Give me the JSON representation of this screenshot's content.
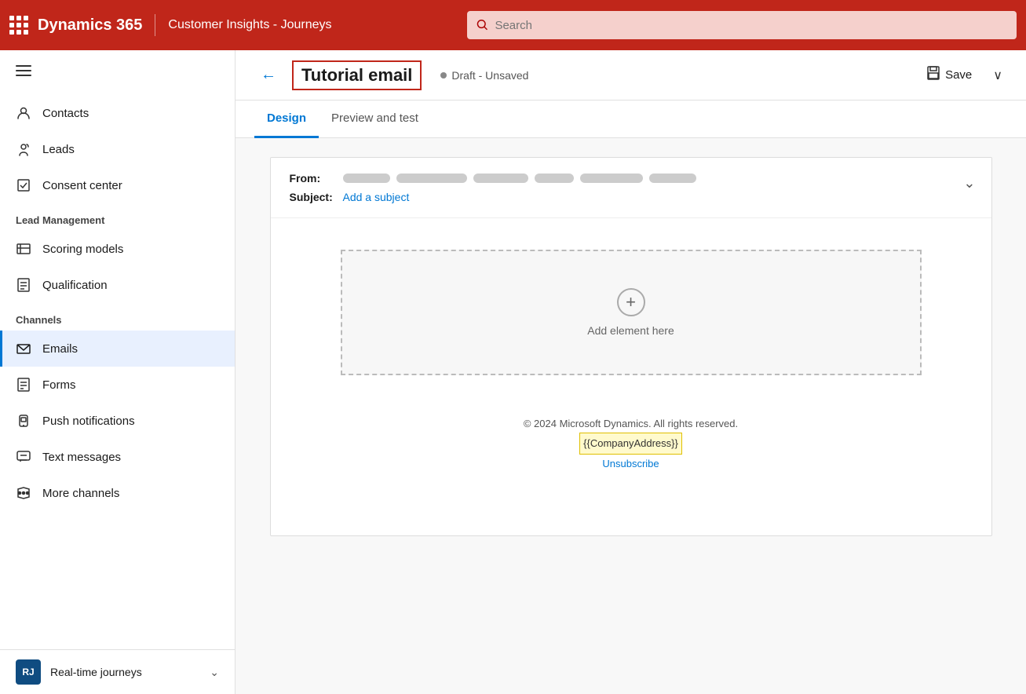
{
  "topbar": {
    "grid_label": "App launcher",
    "title": "Dynamics 365",
    "app_name": "Customer Insights - Journeys",
    "search_placeholder": "Search"
  },
  "sidebar": {
    "hamburger_label": "Navigation menu",
    "nav_items": [
      {
        "id": "contacts",
        "label": "Contacts",
        "icon": "person"
      },
      {
        "id": "leads",
        "label": "Leads",
        "icon": "leads"
      },
      {
        "id": "consent-center",
        "label": "Consent center",
        "icon": "consent"
      }
    ],
    "lead_management": {
      "label": "Lead Management",
      "items": [
        {
          "id": "scoring-models",
          "label": "Scoring models",
          "icon": "scoring"
        },
        {
          "id": "qualification",
          "label": "Qualification",
          "icon": "qualification"
        }
      ]
    },
    "channels": {
      "label": "Channels",
      "items": [
        {
          "id": "emails",
          "label": "Emails",
          "icon": "email",
          "active": true
        },
        {
          "id": "forms",
          "label": "Forms",
          "icon": "forms"
        },
        {
          "id": "push-notifications",
          "label": "Push notifications",
          "icon": "push"
        },
        {
          "id": "text-messages",
          "label": "Text messages",
          "icon": "sms"
        },
        {
          "id": "more-channels",
          "label": "More channels",
          "icon": "more"
        }
      ]
    },
    "bottom": {
      "avatar": "RJ",
      "label": "Real-time journeys",
      "chevron": "⌃"
    }
  },
  "content_header": {
    "back_label": "←",
    "page_title": "Tutorial email",
    "status_text": "Draft - Unsaved",
    "save_label": "Save",
    "chevron_label": "∨"
  },
  "tabs": [
    {
      "id": "design",
      "label": "Design",
      "active": true
    },
    {
      "id": "preview-and-test",
      "label": "Preview and test",
      "active": false
    }
  ],
  "email_editor": {
    "from_label": "From:",
    "from_value_blurred": true,
    "subject_label": "Subject:",
    "add_subject_link": "Add a subject",
    "add_element_label": "Add element here",
    "footer": {
      "copyright": "© 2024 Microsoft Dynamics. All rights reserved.",
      "company_address": "{{CompanyAddress}}",
      "unsubscribe": "Unsubscribe"
    }
  }
}
